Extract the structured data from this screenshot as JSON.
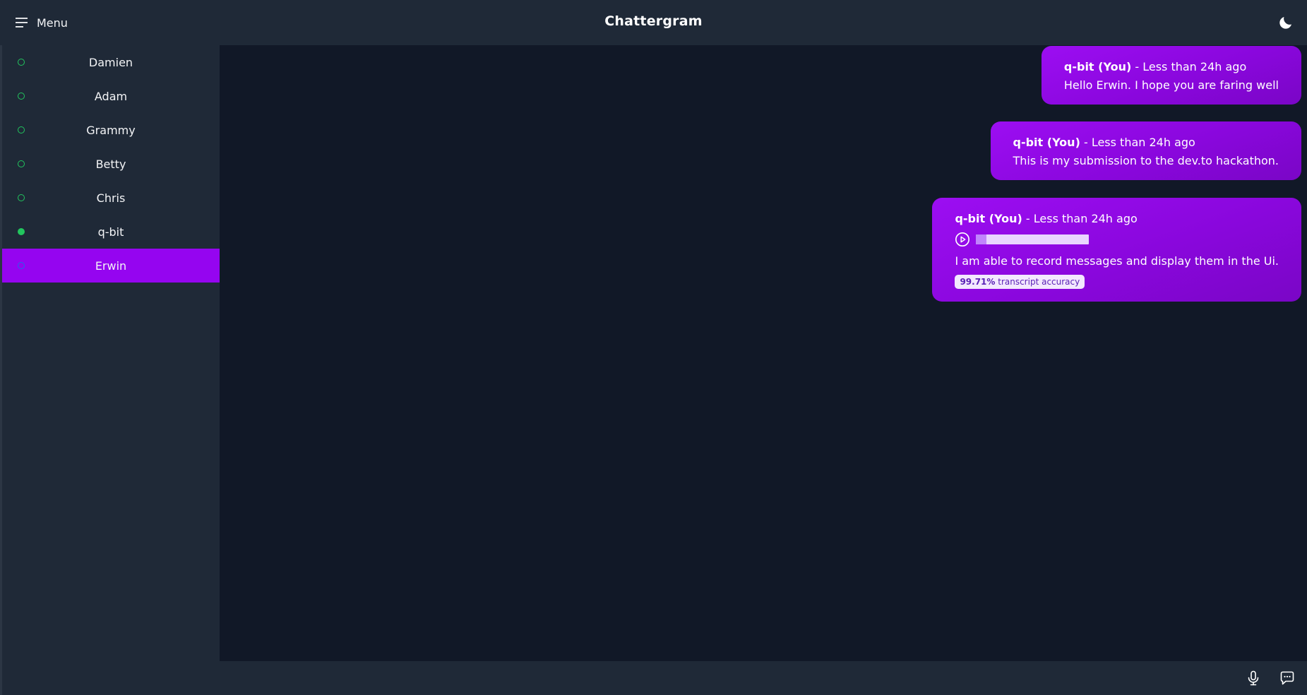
{
  "header": {
    "menu_label": "Menu",
    "title": "Chattergram",
    "theme_icon": "moon-icon"
  },
  "sidebar": {
    "contacts": [
      {
        "name": "Damien",
        "status": "offline"
      },
      {
        "name": "Adam",
        "status": "offline"
      },
      {
        "name": "Grammy",
        "status": "offline"
      },
      {
        "name": "Betty",
        "status": "offline"
      },
      {
        "name": "Chris",
        "status": "offline"
      },
      {
        "name": "q-bit",
        "status": "online"
      },
      {
        "name": "Erwin",
        "status": "offline",
        "selected": true
      }
    ]
  },
  "messages": [
    {
      "author": "q-bit (You)",
      "time": " - Less than 24h ago",
      "text": "Hello Erwin. I hope you are faring well"
    },
    {
      "author": "q-bit (You)",
      "time": " - Less than 24h ago",
      "text": "This is my submission to the dev.to hackathon."
    },
    {
      "author": "q-bit (You)",
      "time": " - Less than 24h ago",
      "text": "I am able to record messages and display them in the Ui.",
      "audio_progress": 0.09,
      "accuracy_value": "99.71%",
      "accuracy_label": " transcript accuracy"
    }
  ],
  "footer": {
    "mic_icon": "microphone-icon",
    "chat_icon": "chat-bubble-icon"
  },
  "colors": {
    "accent": "#9505f0",
    "online": "#22c55e",
    "background": "#111827",
    "panel": "#1f2937"
  }
}
